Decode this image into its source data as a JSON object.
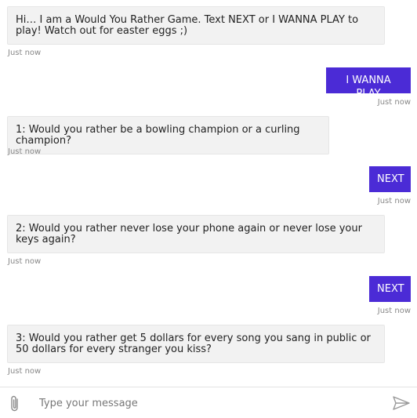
{
  "messages": [
    {
      "sender": "bot",
      "text": "Hi… I am a Would You Rather Game. Text NEXT or I WANNA PLAY to play! Watch out for easter eggs ;)",
      "time": "Just now"
    },
    {
      "sender": "user",
      "text": "I WANNA PLAY",
      "time": "Just now"
    },
    {
      "sender": "bot",
      "text": "1: Would you rather be a bowling champion or a curling champion?",
      "time": "Just now"
    },
    {
      "sender": "user",
      "text": "NEXT",
      "time": "Just now"
    },
    {
      "sender": "bot",
      "text": "2: Would you rather never lose your phone again or never lose your keys again?",
      "time": "Just now"
    },
    {
      "sender": "user",
      "text": "NEXT",
      "time": "Just now"
    },
    {
      "sender": "bot",
      "text": "3: Would you rather get 5 dollars for every song you sang in public or 50 dollars for every stranger you kiss?",
      "time": "Just now"
    }
  ],
  "composer": {
    "placeholder": "Type your message",
    "attach_icon": "paperclip-icon",
    "send_icon": "send-icon"
  },
  "colors": {
    "user_bubble": "#4b2bd6",
    "bot_bubble": "#f2f2f2"
  }
}
